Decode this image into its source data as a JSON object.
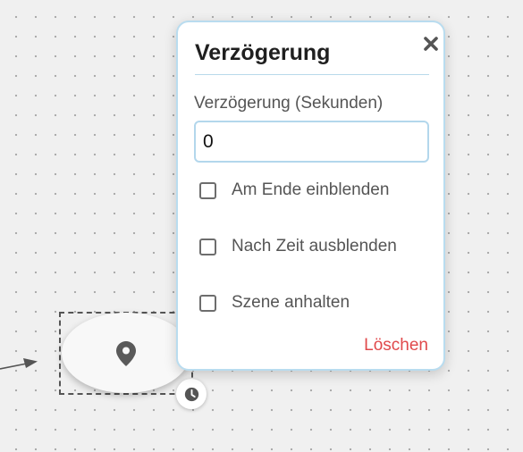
{
  "popup": {
    "title": "Verzögerung",
    "close_icon": "close-icon",
    "field_label": "Verzögerung (Sekunden)",
    "delay_value": "0",
    "options": [
      {
        "label": "Am Ende einblenden",
        "checked": false
      },
      {
        "label": "Nach Zeit ausblenden",
        "checked": false
      },
      {
        "label": "Szene anhalten",
        "checked": false
      }
    ],
    "delete_label": "Löschen"
  },
  "node": {
    "icon": "map-pin-icon",
    "badge_icon": "clock-icon"
  },
  "colors": {
    "background": "#f0f0f0",
    "popup_border": "#b9dcef",
    "delete": "#e0494b",
    "icon": "#5a5a5a"
  }
}
